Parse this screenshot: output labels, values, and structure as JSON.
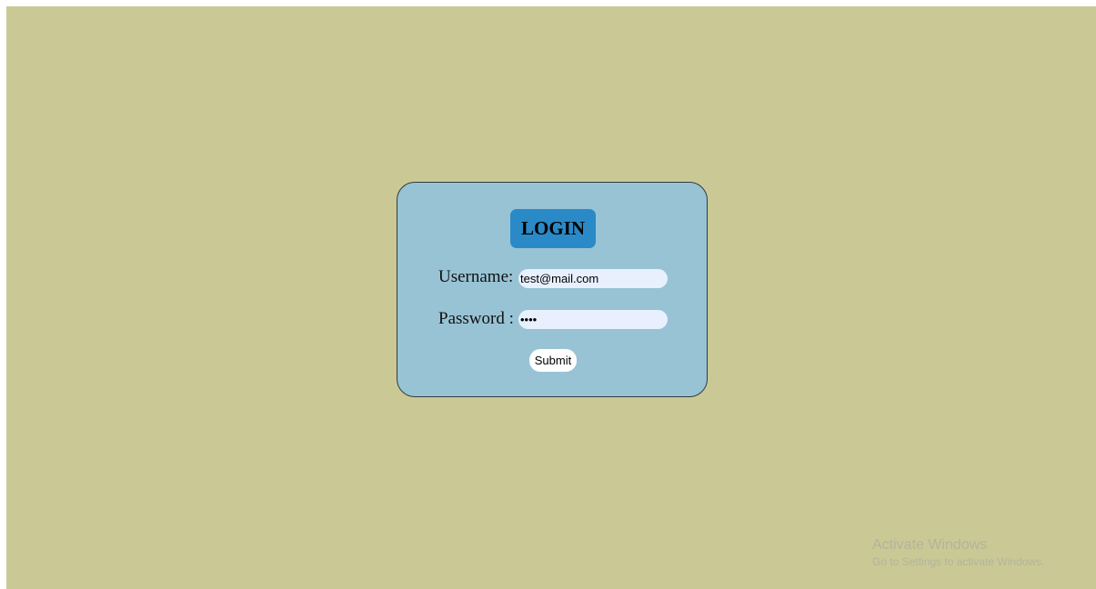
{
  "colors": {
    "background": "#cac995",
    "card": "#98c3d4",
    "title_box": "#2a8ac8",
    "input_fill": "#e8f0fe"
  },
  "login": {
    "title": "LOGIN",
    "username_label": "Username:",
    "username_value": "test@mail.com",
    "password_label": "Password :",
    "password_value": "test",
    "submit_label": "Submit"
  },
  "watermark": {
    "title": "Activate Windows",
    "subtitle": "Go to Settings to activate Windows."
  }
}
